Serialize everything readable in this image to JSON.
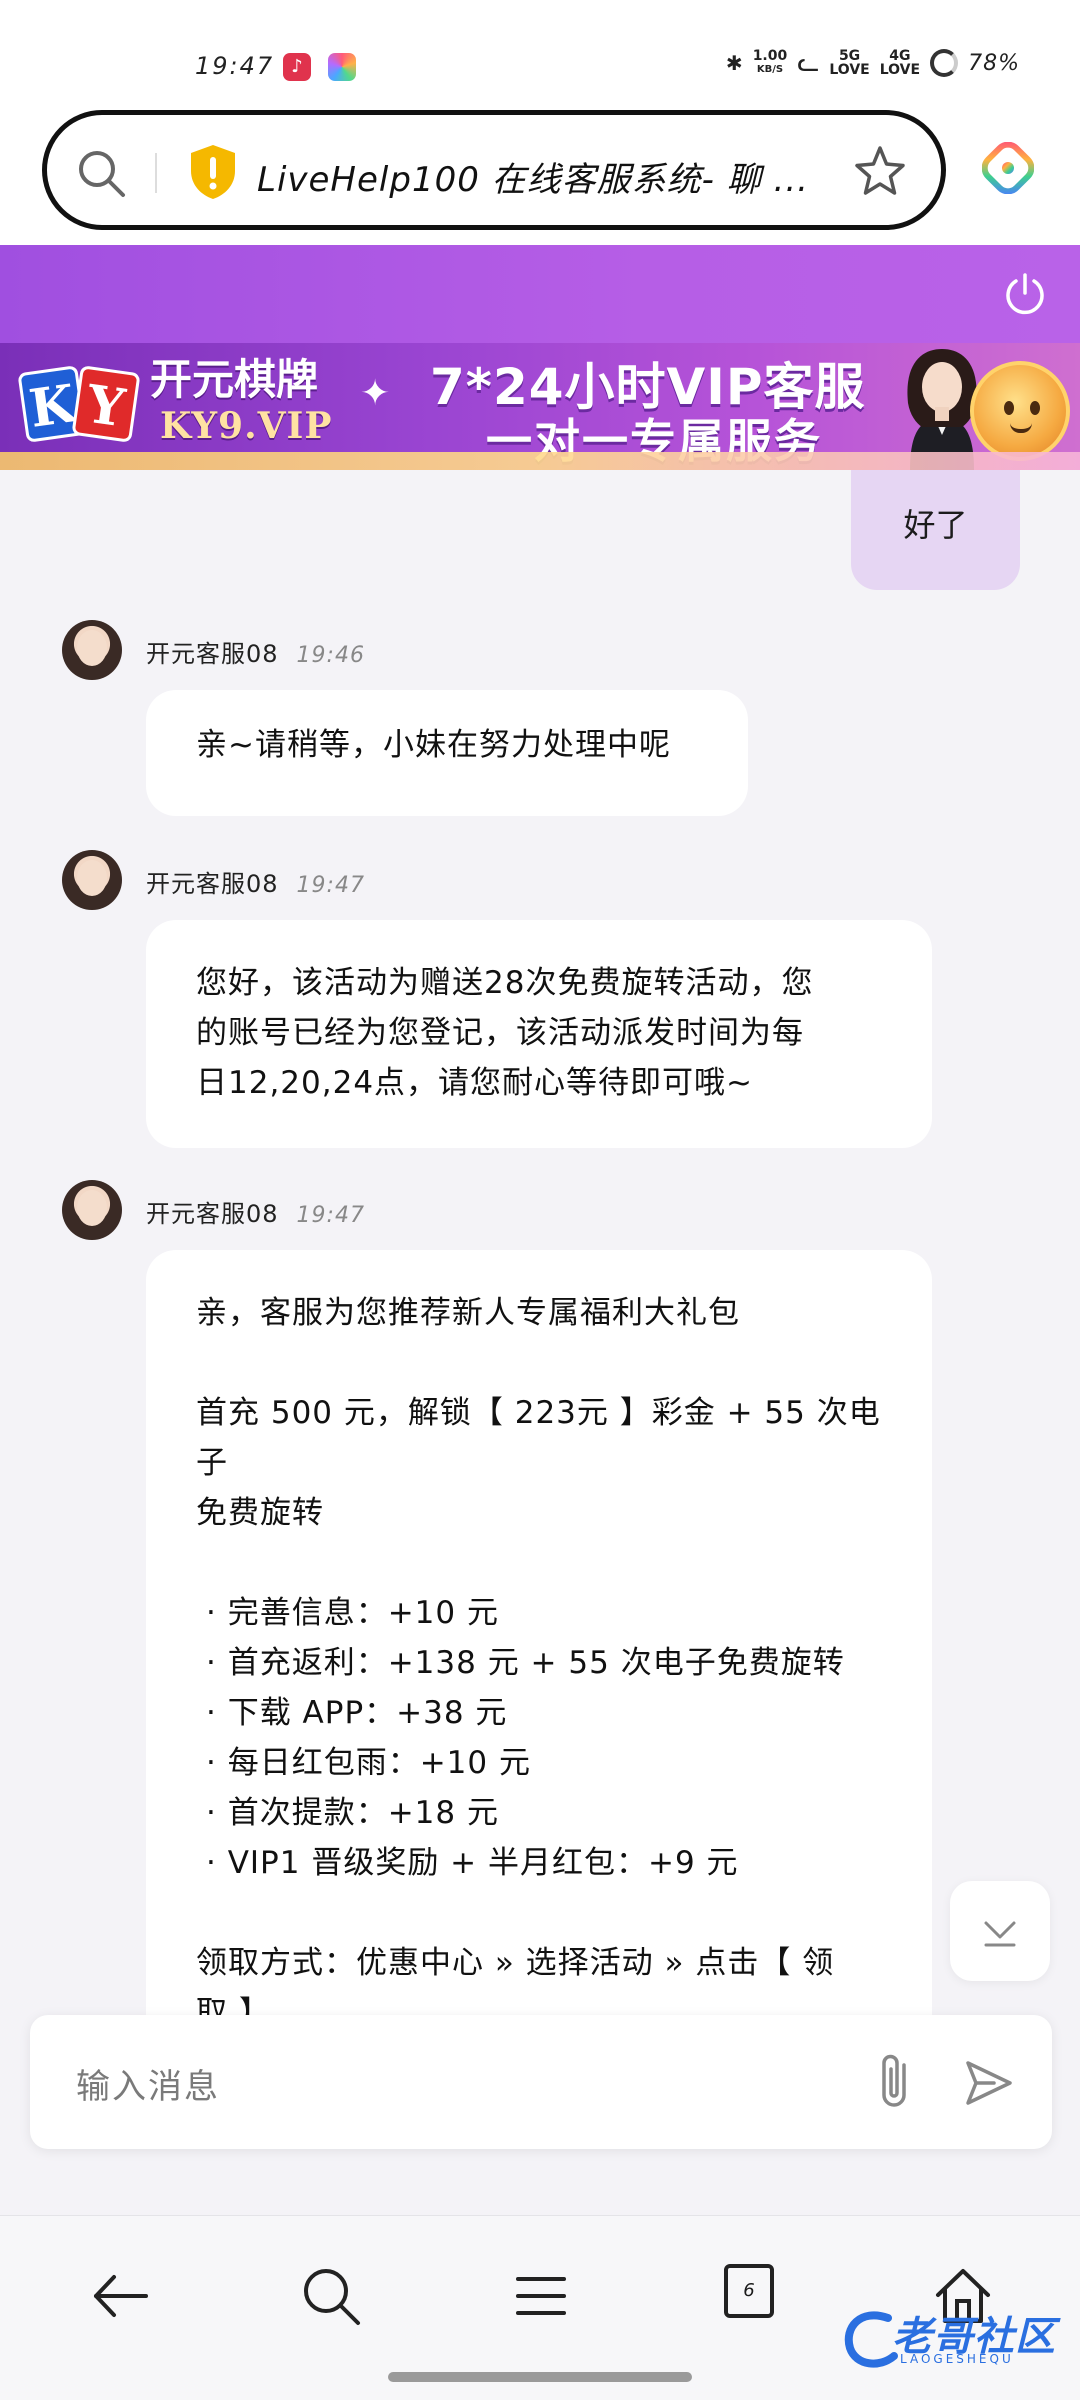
{
  "status_bar": {
    "time": "19:47",
    "speed_value": "1.00",
    "speed_unit": "KB/S",
    "signal1": "5G",
    "signal2": "4G",
    "love": "LOVE",
    "battery": "78%"
  },
  "url_bar": {
    "title": "LiveHelp100 在线客服系统- 聊 ..."
  },
  "banner": {
    "brand": "开元棋牌",
    "domain": "KY9.VIP",
    "line1": "7*24小时VIP客服",
    "line2": "一对一专属服务",
    "logo_k": "K",
    "logo_y": "Y",
    "badge": "24"
  },
  "chat": {
    "my_message": "好了",
    "messages": [
      {
        "sender": "开元客服08",
        "time": "19:46",
        "lines": [
          "亲~请稍等，小妹在努力处理中呢"
        ]
      },
      {
        "sender": "开元客服08",
        "time": "19:47",
        "lines": [
          "您好，该活动为赠送28次免费旋转活动，您",
          "的账号已经为您登记，该活动派发时间为每",
          "日12,20,24点，请您耐心等待即可哦~"
        ]
      },
      {
        "sender": "开元客服08",
        "time": "19:47",
        "intro": "亲，客服为您推荐新人专属福利大礼包",
        "offer_line1": "首充 500 元，解锁【 223元 】彩金 + 55 次电子",
        "offer_line2": "免费旋转",
        "bullets": [
          "· 完善信息：+10 元",
          "· 首充返利：+138 元 + 55 次电子免费旋转",
          "· 下载 APP：+38 元",
          "· 每日红包雨：+10 元",
          "· 首次提款：+18 元",
          "· VIP1 晋级奖励 + 半月红包：+9 元"
        ],
        "claim_line1": "领取方式：优惠中心 » 选择活动 » 点击【 领",
        "claim_line2": "取 】"
      }
    ]
  },
  "input": {
    "placeholder": "输入消息"
  },
  "bottom_nav": {
    "tab_count": "6"
  },
  "watermark": {
    "text": "老哥社区",
    "sub": "LAOGESHEQU"
  },
  "colors": {
    "header_purple": "#a04fe0",
    "my_bubble": "#e6d6f3",
    "shield_yellow": "#f5b800"
  },
  "icons": [
    "search-icon",
    "shield-icon",
    "star-icon",
    "extension-icon",
    "power-icon",
    "chevron-down-icon",
    "paperclip-icon",
    "send-icon",
    "back-icon",
    "menu-icon",
    "tabs-icon",
    "home-icon"
  ]
}
